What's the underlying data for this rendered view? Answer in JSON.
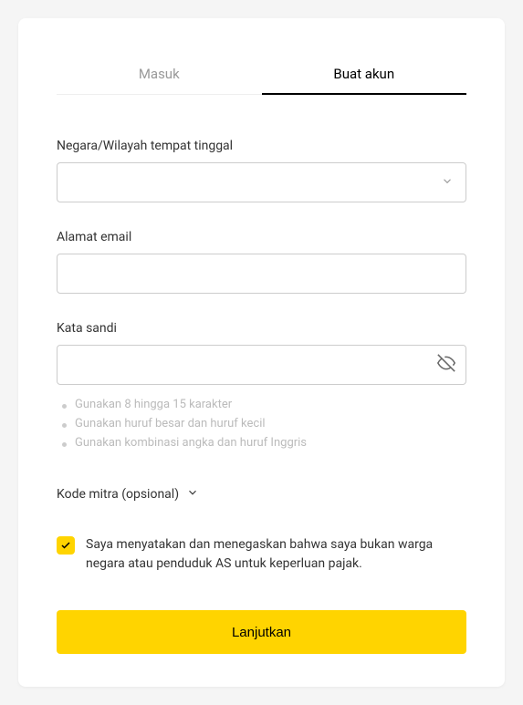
{
  "tabs": {
    "login": "Masuk",
    "signup": "Buat akun"
  },
  "fields": {
    "country": {
      "label": "Negara/Wilayah tempat tinggal"
    },
    "email": {
      "label": "Alamat email"
    },
    "password": {
      "label": "Kata sandi",
      "hints": [
        "Gunakan 8 hingga 15 karakter",
        "Gunakan huruf besar dan huruf kecil",
        "Gunakan kombinasi angka dan huruf Inggris"
      ]
    }
  },
  "partnerCode": {
    "label": "Kode mitra (opsional)"
  },
  "declaration": {
    "text": "Saya menyatakan dan menegaskan bahwa saya bukan warga negara atau penduduk AS untuk keperluan pajak."
  },
  "submit": {
    "label": "Lanjutkan"
  }
}
